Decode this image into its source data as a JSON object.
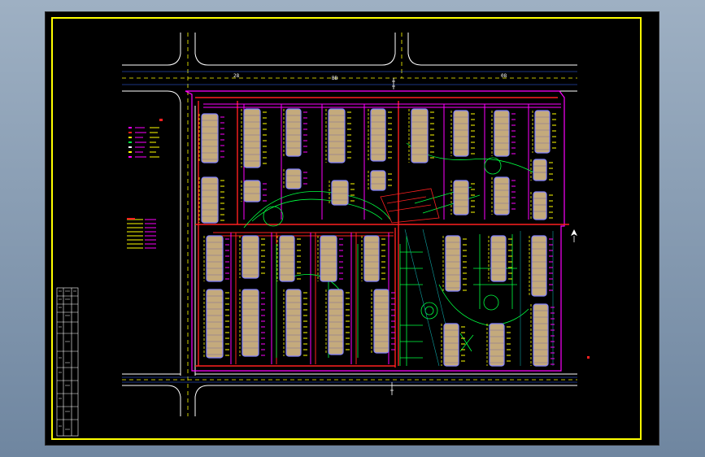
{
  "colors": {
    "viewport_top": "#9eb0c3",
    "viewport_bottom": "#6f86a0",
    "sheet": "#000000",
    "frame": "#ffff00",
    "road_edge": "#ffffff",
    "road_centerline": "#ffff00",
    "site_boundary": "#ff00ff",
    "pipe_red": "#ff2020",
    "building_outline": "#8080ff",
    "building_fill": "#c4aa7c",
    "landscape": "#00ff40",
    "annotation": "#ffff00"
  },
  "road_labels": {
    "top_left": "28",
    "top_middle": "BB",
    "top_right": "08"
  },
  "icons": {
    "north_arrow": "north-arrow-icon",
    "legend_swatches": "legend-swatch-icon"
  }
}
